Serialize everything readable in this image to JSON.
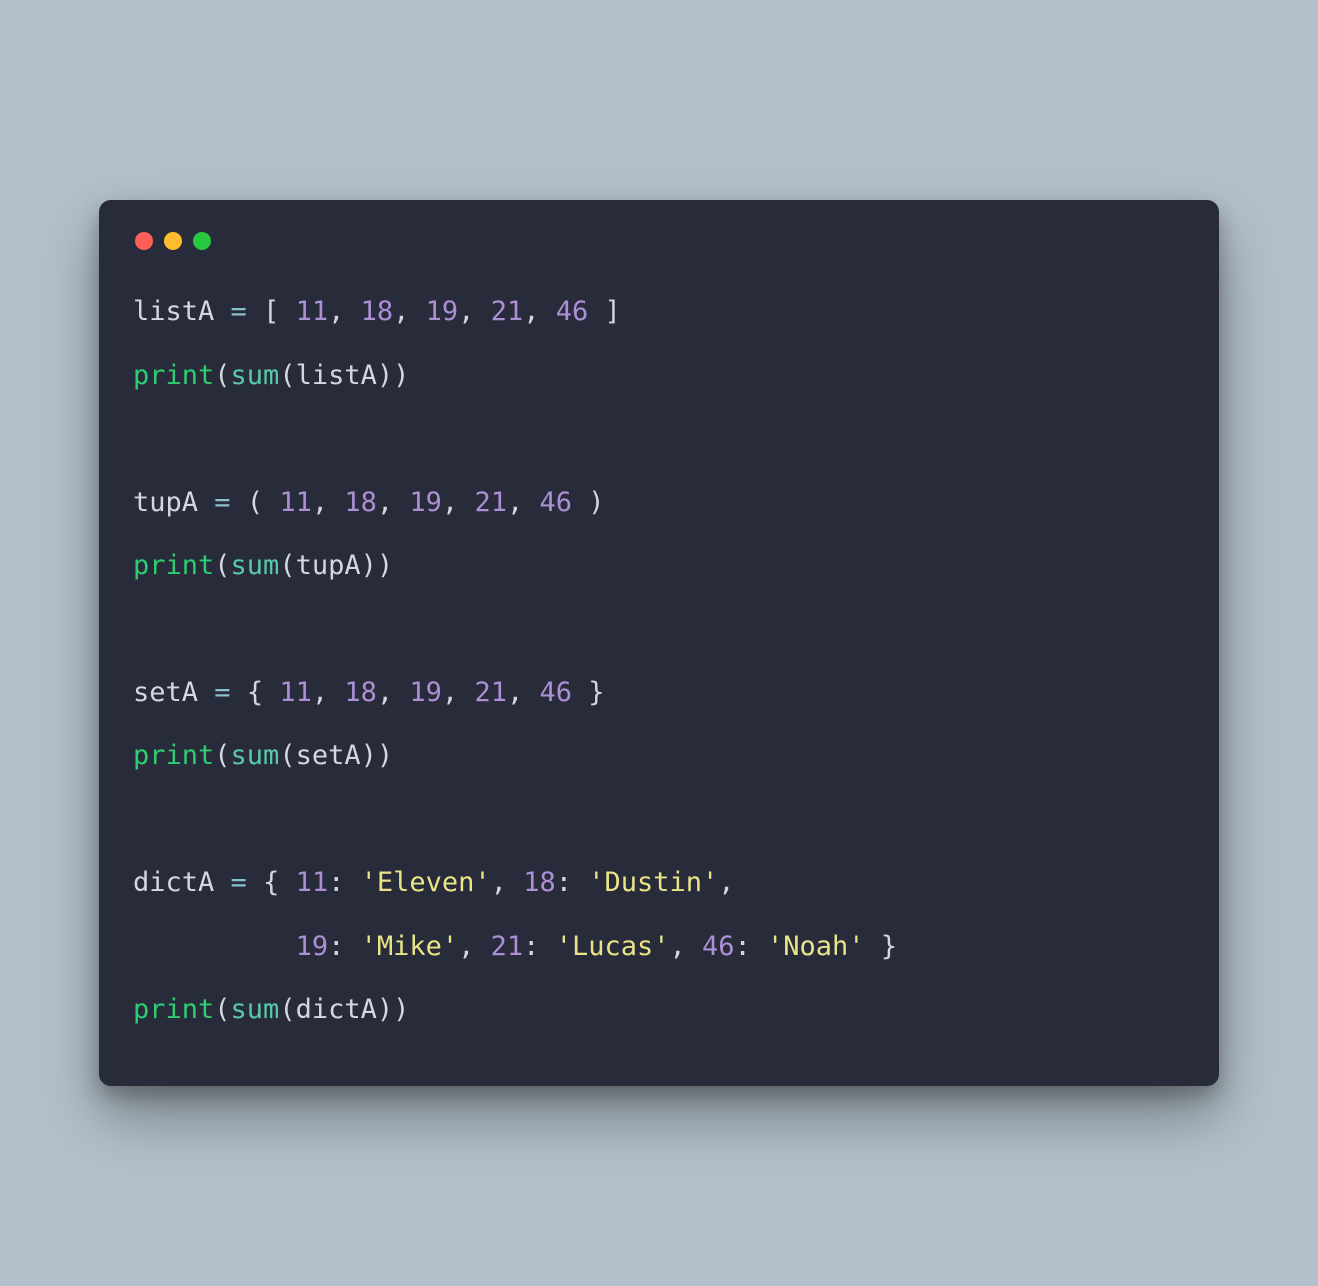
{
  "window": {
    "traffic_lights": [
      "close",
      "minimize",
      "zoom"
    ]
  },
  "code": {
    "colors": {
      "identifier": "#d5d6df",
      "operator": "#88c0d0",
      "punctuation": "#d5d6df",
      "number": "#ac8fd4",
      "function": "#2ecd71",
      "builtin": "#59c9a9",
      "string": "#e9e487",
      "background": "#272b3a"
    },
    "tokens": [
      [
        [
          "id",
          "listA"
        ],
        [
          "punc",
          " "
        ],
        [
          "op",
          "="
        ],
        [
          "punc",
          " [ "
        ],
        [
          "num",
          "11"
        ],
        [
          "punc",
          ", "
        ],
        [
          "num",
          "18"
        ],
        [
          "punc",
          ", "
        ],
        [
          "num",
          "19"
        ],
        [
          "punc",
          ", "
        ],
        [
          "num",
          "21"
        ],
        [
          "punc",
          ", "
        ],
        [
          "num",
          "46"
        ],
        [
          "punc",
          " ]"
        ]
      ],
      [
        [
          "fn",
          "print"
        ],
        [
          "punc",
          "("
        ],
        [
          "bfn",
          "sum"
        ],
        [
          "punc",
          "("
        ],
        [
          "id",
          "listA"
        ],
        [
          "punc",
          "))"
        ]
      ],
      [],
      [
        [
          "id",
          "tupA"
        ],
        [
          "punc",
          " "
        ],
        [
          "op",
          "="
        ],
        [
          "punc",
          " ( "
        ],
        [
          "num",
          "11"
        ],
        [
          "punc",
          ", "
        ],
        [
          "num",
          "18"
        ],
        [
          "punc",
          ", "
        ],
        [
          "num",
          "19"
        ],
        [
          "punc",
          ", "
        ],
        [
          "num",
          "21"
        ],
        [
          "punc",
          ", "
        ],
        [
          "num",
          "46"
        ],
        [
          "punc",
          " )"
        ]
      ],
      [
        [
          "fn",
          "print"
        ],
        [
          "punc",
          "("
        ],
        [
          "bfn",
          "sum"
        ],
        [
          "punc",
          "("
        ],
        [
          "id",
          "tupA"
        ],
        [
          "punc",
          "))"
        ]
      ],
      [],
      [
        [
          "id",
          "setA"
        ],
        [
          "punc",
          " "
        ],
        [
          "op",
          "="
        ],
        [
          "punc",
          " { "
        ],
        [
          "num",
          "11"
        ],
        [
          "punc",
          ", "
        ],
        [
          "num",
          "18"
        ],
        [
          "punc",
          ", "
        ],
        [
          "num",
          "19"
        ],
        [
          "punc",
          ", "
        ],
        [
          "num",
          "21"
        ],
        [
          "punc",
          ", "
        ],
        [
          "num",
          "46"
        ],
        [
          "punc",
          " }"
        ]
      ],
      [
        [
          "fn",
          "print"
        ],
        [
          "punc",
          "("
        ],
        [
          "bfn",
          "sum"
        ],
        [
          "punc",
          "("
        ],
        [
          "id",
          "setA"
        ],
        [
          "punc",
          "))"
        ]
      ],
      [],
      [
        [
          "id",
          "dictA"
        ],
        [
          "punc",
          " "
        ],
        [
          "op",
          "="
        ],
        [
          "punc",
          " { "
        ],
        [
          "num",
          "11"
        ],
        [
          "punc",
          ": "
        ],
        [
          "str",
          "'Eleven'"
        ],
        [
          "punc",
          ", "
        ],
        [
          "num",
          "18"
        ],
        [
          "punc",
          ": "
        ],
        [
          "str",
          "'Dustin'"
        ],
        [
          "punc",
          ", "
        ]
      ],
      [
        [
          "punc",
          "          "
        ],
        [
          "num",
          "19"
        ],
        [
          "punc",
          ": "
        ],
        [
          "str",
          "'Mike'"
        ],
        [
          "punc",
          ", "
        ],
        [
          "num",
          "21"
        ],
        [
          "punc",
          ": "
        ],
        [
          "str",
          "'Lucas'"
        ],
        [
          "punc",
          ", "
        ],
        [
          "num",
          "46"
        ],
        [
          "punc",
          ": "
        ],
        [
          "str",
          "'Noah'"
        ],
        [
          "punc",
          " }"
        ]
      ],
      [
        [
          "fn",
          "print"
        ],
        [
          "punc",
          "("
        ],
        [
          "bfn",
          "sum"
        ],
        [
          "punc",
          "("
        ],
        [
          "id",
          "dictA"
        ],
        [
          "punc",
          "))"
        ]
      ]
    ]
  }
}
